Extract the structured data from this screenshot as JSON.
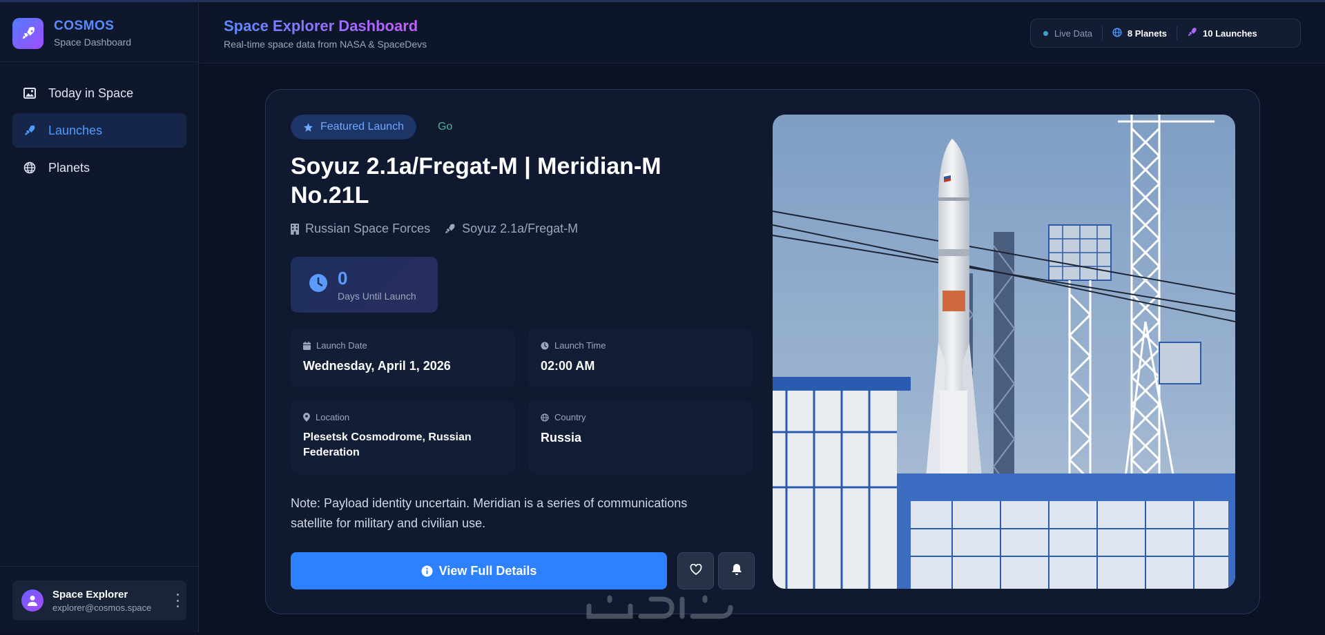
{
  "sidebar": {
    "brand_title": "COSMOS",
    "brand_subtitle": "Space Dashboard",
    "items": [
      {
        "label": "Today in Space",
        "icon": "image-icon",
        "active": false
      },
      {
        "label": "Launches",
        "icon": "rocket-icon",
        "active": true
      },
      {
        "label": "Planets",
        "icon": "globe-icon",
        "active": false
      }
    ],
    "user": {
      "name": "Space Explorer",
      "email": "explorer@cosmos.space"
    }
  },
  "header": {
    "title": "Space Explorer Dashboard",
    "subtitle": "Real-time space data from NASA & SpaceDevs",
    "stats": {
      "live": "Live Data",
      "planets": "8 Planets",
      "launches": "10 Launches"
    }
  },
  "launch": {
    "badge": "Featured Launch",
    "status": "Go",
    "title": "Soyuz 2.1a/Fregat-M | Meridian-M No.21L",
    "provider": "Russian Space Forces",
    "rocket": "Soyuz 2.1a/Fregat-M",
    "countdown_value": "0",
    "countdown_label": "Days Until Launch",
    "date_label": "Launch Date",
    "date_value": "Wednesday, April 1, 2026",
    "time_label": "Launch Time",
    "time_value": "02:00 AM",
    "location_label": "Location",
    "location_value": "Plesetsk Cosmodrome, Russian Federation",
    "country_label": "Country",
    "country_value": "Russia",
    "note": "Note: Payload identity uncertain. Meridian is a series of communications satellite for military and civilian use.",
    "details_button": "View Full Details"
  },
  "colors": {
    "accent": "#2d80ff",
    "background": "#0b1224",
    "status_go": "#48b2a8"
  }
}
